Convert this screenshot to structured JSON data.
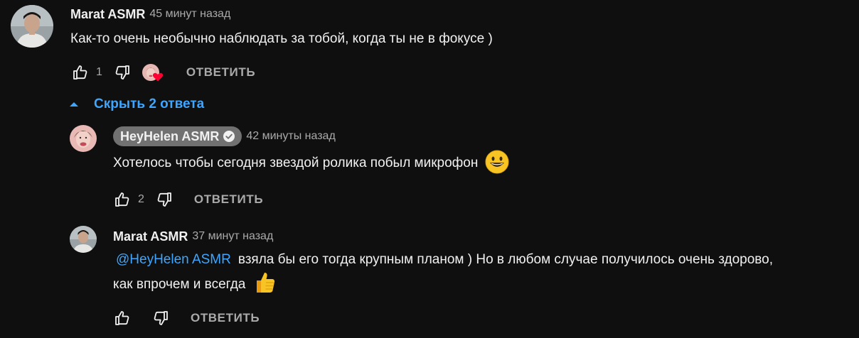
{
  "comments": [
    {
      "author": "Marat ASMR",
      "time": "45 минут назад",
      "text": "Как-то очень необычно наблюдать за тобой, когда ты не в фокусе )",
      "likes": "1",
      "reply_label": "ОТВЕТИТЬ",
      "creator_heart": true
    }
  ],
  "replies_toggle": {
    "label": "Скрыть 2 ответа",
    "icon": "chevron-up-icon"
  },
  "replies": [
    {
      "author": "HeyHelen ASMR",
      "verified": true,
      "time": "42 минуты назад",
      "text": "Хотелось чтобы сегодня звездой ролика побыл микрофон",
      "emoji": "grinning-face-emoji",
      "likes": "2",
      "reply_label": "ОТВЕТИТЬ"
    },
    {
      "author": "Marat ASMR",
      "time": "37 минут назад",
      "mention": "@HeyHelen ASMR",
      "text_line1": "взяла бы его тогда крупным планом ) Но в любом случае получилось очень здорово,",
      "text_line2": "как впрочем и всегда",
      "emoji": "thumbs-up-emoji",
      "likes": "",
      "reply_label": "ОТВЕТИТЬ"
    }
  ],
  "colors": {
    "background": "#0f0f0f",
    "text": "#f1f1f1",
    "secondary": "#aaaaaa",
    "link": "#3ea6ff",
    "author_pill": "#717171",
    "heart": "#ff0033"
  }
}
